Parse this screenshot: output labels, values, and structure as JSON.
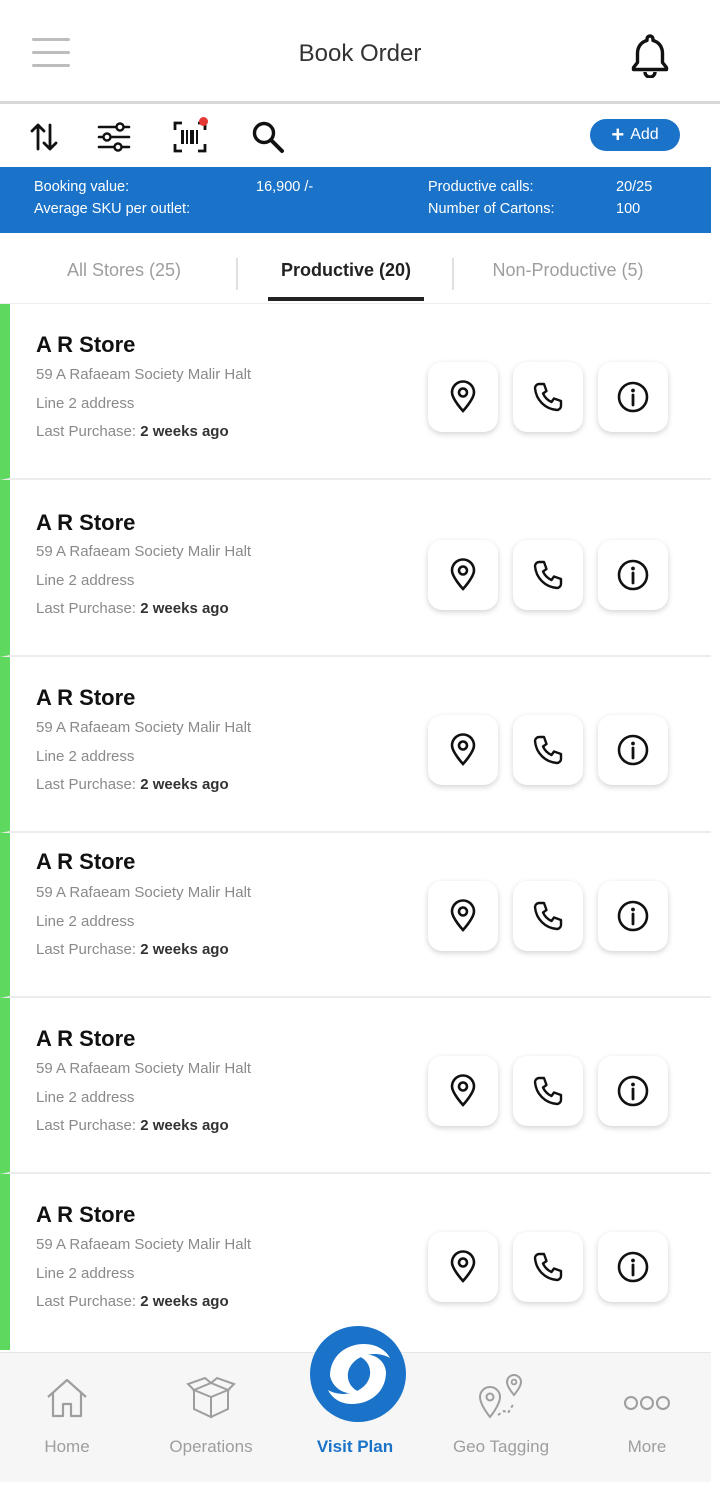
{
  "header": {
    "title": "Book Order"
  },
  "toolbar": {
    "add_label": "Add"
  },
  "stats": {
    "booking_value_label": "Booking value:",
    "booking_value": "16,900 /-",
    "avg_sku_label": "Average SKU per outlet:",
    "productive_calls_label": "Productive calls:",
    "productive_calls": "20/25",
    "cartons_label": "Number of Cartons:",
    "cartons": "100"
  },
  "tabs": [
    {
      "label": "All Stores (25)"
    },
    {
      "label": "Productive (20)"
    },
    {
      "label": "Non-Productive (5)"
    }
  ],
  "stores": [
    {
      "name": "A R Store",
      "address1": "59 A Rafaeam Society Malir Halt",
      "address2": "Line 2 address",
      "last_purchase_label": "Last Purchase:",
      "last_purchase": "2 weeks ago"
    },
    {
      "name": "A R Store",
      "address1": "59 A Rafaeam Society Malir Halt",
      "address2": "Line 2 address",
      "last_purchase_label": "Last Purchase:",
      "last_purchase": "2 weeks ago"
    },
    {
      "name": "A R Store",
      "address1": "59 A Rafaeam Society Malir Halt",
      "address2": "Line 2 address",
      "last_purchase_label": "Last Purchase:",
      "last_purchase": "2 weeks ago"
    },
    {
      "name": "A R Store",
      "address1": "59 A Rafaeam Society Malir Halt",
      "address2": "Line 2 address",
      "last_purchase_label": "Last Purchase:",
      "last_purchase": "2 weeks ago"
    },
    {
      "name": "A R Store",
      "address1": "59 A Rafaeam Society Malir Halt",
      "address2": "Line 2 address",
      "last_purchase_label": "Last Purchase:",
      "last_purchase": "2 weeks ago"
    },
    {
      "name": "A R Store",
      "address1": "59 A Rafaeam Society Malir Halt",
      "address2": "Line 2 address",
      "last_purchase_label": "Last Purchase:",
      "last_purchase": "2 weeks ago"
    }
  ],
  "bottom_nav": [
    {
      "label": "Home",
      "icon": "home-icon"
    },
    {
      "label": "Operations",
      "icon": "box-icon"
    },
    {
      "label": "Visit Plan",
      "icon": "visit-plan-logo-icon"
    },
    {
      "label": "Geo Tagging",
      "icon": "geo-tag-icon"
    },
    {
      "label": "More",
      "icon": "more-icon"
    }
  ],
  "colors": {
    "primary": "#1a73c8",
    "accent_green": "#5fd85f",
    "notification_dot": "#e53935"
  }
}
